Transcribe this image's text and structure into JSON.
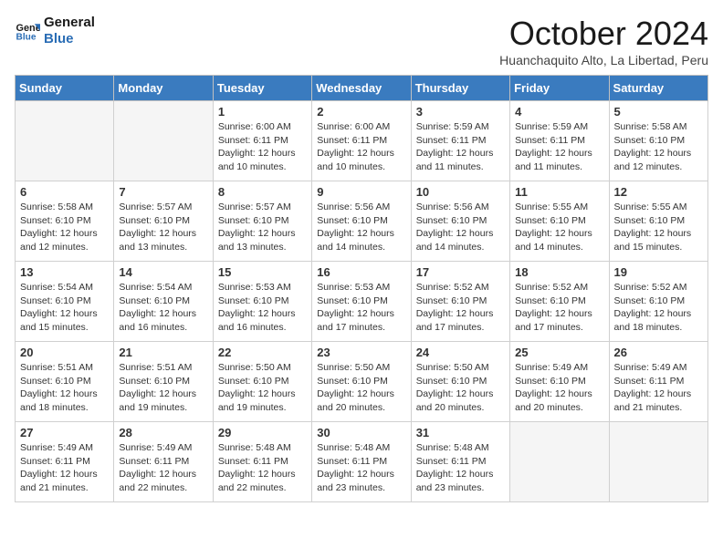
{
  "logo": {
    "line1": "General",
    "line2": "Blue"
  },
  "title": "October 2024",
  "subtitle": "Huanchaquito Alto, La Libertad, Peru",
  "days_of_week": [
    "Sunday",
    "Monday",
    "Tuesday",
    "Wednesday",
    "Thursday",
    "Friday",
    "Saturday"
  ],
  "weeks": [
    [
      {
        "day": "",
        "info": ""
      },
      {
        "day": "",
        "info": ""
      },
      {
        "day": "1",
        "info": "Sunrise: 6:00 AM\nSunset: 6:11 PM\nDaylight: 12 hours and 10 minutes."
      },
      {
        "day": "2",
        "info": "Sunrise: 6:00 AM\nSunset: 6:11 PM\nDaylight: 12 hours and 10 minutes."
      },
      {
        "day": "3",
        "info": "Sunrise: 5:59 AM\nSunset: 6:11 PM\nDaylight: 12 hours and 11 minutes."
      },
      {
        "day": "4",
        "info": "Sunrise: 5:59 AM\nSunset: 6:11 PM\nDaylight: 12 hours and 11 minutes."
      },
      {
        "day": "5",
        "info": "Sunrise: 5:58 AM\nSunset: 6:10 PM\nDaylight: 12 hours and 12 minutes."
      }
    ],
    [
      {
        "day": "6",
        "info": "Sunrise: 5:58 AM\nSunset: 6:10 PM\nDaylight: 12 hours and 12 minutes."
      },
      {
        "day": "7",
        "info": "Sunrise: 5:57 AM\nSunset: 6:10 PM\nDaylight: 12 hours and 13 minutes."
      },
      {
        "day": "8",
        "info": "Sunrise: 5:57 AM\nSunset: 6:10 PM\nDaylight: 12 hours and 13 minutes."
      },
      {
        "day": "9",
        "info": "Sunrise: 5:56 AM\nSunset: 6:10 PM\nDaylight: 12 hours and 14 minutes."
      },
      {
        "day": "10",
        "info": "Sunrise: 5:56 AM\nSunset: 6:10 PM\nDaylight: 12 hours and 14 minutes."
      },
      {
        "day": "11",
        "info": "Sunrise: 5:55 AM\nSunset: 6:10 PM\nDaylight: 12 hours and 14 minutes."
      },
      {
        "day": "12",
        "info": "Sunrise: 5:55 AM\nSunset: 6:10 PM\nDaylight: 12 hours and 15 minutes."
      }
    ],
    [
      {
        "day": "13",
        "info": "Sunrise: 5:54 AM\nSunset: 6:10 PM\nDaylight: 12 hours and 15 minutes."
      },
      {
        "day": "14",
        "info": "Sunrise: 5:54 AM\nSunset: 6:10 PM\nDaylight: 12 hours and 16 minutes."
      },
      {
        "day": "15",
        "info": "Sunrise: 5:53 AM\nSunset: 6:10 PM\nDaylight: 12 hours and 16 minutes."
      },
      {
        "day": "16",
        "info": "Sunrise: 5:53 AM\nSunset: 6:10 PM\nDaylight: 12 hours and 17 minutes."
      },
      {
        "day": "17",
        "info": "Sunrise: 5:52 AM\nSunset: 6:10 PM\nDaylight: 12 hours and 17 minutes."
      },
      {
        "day": "18",
        "info": "Sunrise: 5:52 AM\nSunset: 6:10 PM\nDaylight: 12 hours and 17 minutes."
      },
      {
        "day": "19",
        "info": "Sunrise: 5:52 AM\nSunset: 6:10 PM\nDaylight: 12 hours and 18 minutes."
      }
    ],
    [
      {
        "day": "20",
        "info": "Sunrise: 5:51 AM\nSunset: 6:10 PM\nDaylight: 12 hours and 18 minutes."
      },
      {
        "day": "21",
        "info": "Sunrise: 5:51 AM\nSunset: 6:10 PM\nDaylight: 12 hours and 19 minutes."
      },
      {
        "day": "22",
        "info": "Sunrise: 5:50 AM\nSunset: 6:10 PM\nDaylight: 12 hours and 19 minutes."
      },
      {
        "day": "23",
        "info": "Sunrise: 5:50 AM\nSunset: 6:10 PM\nDaylight: 12 hours and 20 minutes."
      },
      {
        "day": "24",
        "info": "Sunrise: 5:50 AM\nSunset: 6:10 PM\nDaylight: 12 hours and 20 minutes."
      },
      {
        "day": "25",
        "info": "Sunrise: 5:49 AM\nSunset: 6:10 PM\nDaylight: 12 hours and 20 minutes."
      },
      {
        "day": "26",
        "info": "Sunrise: 5:49 AM\nSunset: 6:11 PM\nDaylight: 12 hours and 21 minutes."
      }
    ],
    [
      {
        "day": "27",
        "info": "Sunrise: 5:49 AM\nSunset: 6:11 PM\nDaylight: 12 hours and 21 minutes."
      },
      {
        "day": "28",
        "info": "Sunrise: 5:49 AM\nSunset: 6:11 PM\nDaylight: 12 hours and 22 minutes."
      },
      {
        "day": "29",
        "info": "Sunrise: 5:48 AM\nSunset: 6:11 PM\nDaylight: 12 hours and 22 minutes."
      },
      {
        "day": "30",
        "info": "Sunrise: 5:48 AM\nSunset: 6:11 PM\nDaylight: 12 hours and 23 minutes."
      },
      {
        "day": "31",
        "info": "Sunrise: 5:48 AM\nSunset: 6:11 PM\nDaylight: 12 hours and 23 minutes."
      },
      {
        "day": "",
        "info": ""
      },
      {
        "day": "",
        "info": ""
      }
    ]
  ]
}
